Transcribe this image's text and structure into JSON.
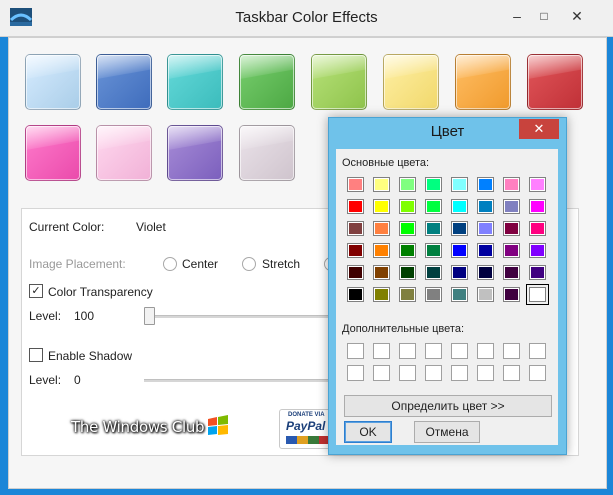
{
  "window": {
    "title": "Taskbar Color Effects",
    "icon": "app-icon",
    "controls": {
      "minimize": "–",
      "maximize": "□",
      "close": "✕"
    }
  },
  "swatches": [
    {
      "color": "#d7ecff",
      "edge": "#a9cde8"
    },
    {
      "color": "#6b95d8",
      "edge": "#3e6cbc"
    },
    {
      "color": "#66dada",
      "edge": "#3bbcbc"
    },
    {
      "color": "#79cf6f",
      "edge": "#4ca843"
    },
    {
      "color": "#b8e27a",
      "edge": "#8ec34b"
    },
    {
      "color": "#fff0a6",
      "edge": "#f1d86b"
    },
    {
      "color": "#ffbf66",
      "edge": "#f09a2c"
    },
    {
      "color": "#e2575b",
      "edge": "#c03037"
    },
    {
      "color": "#ff7ccc",
      "edge": "#ea4aab"
    },
    {
      "color": "#ffd9ef",
      "edge": "#f1b1d7"
    },
    {
      "color": "#a98ed8",
      "edge": "#7b5fbd"
    },
    {
      "color": "#ebe3ea",
      "edge": "#cfc4cd"
    }
  ],
  "panel": {
    "current_color_label": "Current Color:",
    "current_color_value": "Violet",
    "image_placement_label": "Image Placement:",
    "placement_options": [
      "Center",
      "Stretch"
    ],
    "transparency_label": "Color Transparency",
    "transparency_checked": true,
    "level_label_1": "Level:",
    "level_value_1": "100",
    "shadow_label": "Enable Shadow",
    "shadow_checked": false,
    "level_label_2": "Level:",
    "level_value_2": "0",
    "logo_text": "The Windows Club",
    "paypal_top": "DONATE VIA",
    "paypal_brand": "PayPal"
  },
  "dialog": {
    "title": "Цвет",
    "close": "✕",
    "basic_label": "Основные цвета:",
    "basic_colors": [
      "#ff8080",
      "#ffff80",
      "#80ff80",
      "#00ff80",
      "#80ffff",
      "#0080ff",
      "#ff80c0",
      "#ff80ff",
      "#ff0000",
      "#ffff00",
      "#80ff00",
      "#00ff40",
      "#00ffff",
      "#0080c0",
      "#8080c0",
      "#ff00ff",
      "#804040",
      "#ff8040",
      "#00ff00",
      "#008080",
      "#004080",
      "#8080ff",
      "#800040",
      "#ff0080",
      "#800000",
      "#ff8000",
      "#008000",
      "#008040",
      "#0000ff",
      "#0000a0",
      "#800080",
      "#8000ff",
      "#400000",
      "#804000",
      "#004000",
      "#004040",
      "#000080",
      "#000040",
      "#400040",
      "#400080",
      "#000000",
      "#808000",
      "#808040",
      "#808080",
      "#408080",
      "#c0c0c0",
      "#400040",
      "#ffffff"
    ],
    "custom_label": "Дополнительные цвета:",
    "custom_count": 16,
    "define_button": "Определить цвет >>",
    "ok_button": "OK",
    "cancel_button": "Отмена"
  }
}
